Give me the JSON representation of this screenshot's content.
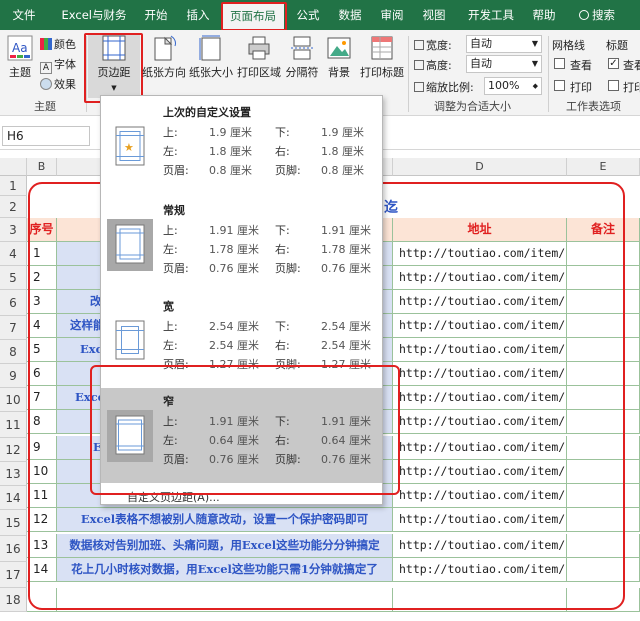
{
  "tabs": [
    "文件",
    "Excel与财务",
    "开始",
    "插入",
    "页面布局",
    "公式",
    "数据",
    "审阅",
    "视图",
    "开发工具",
    "帮助",
    "搜索"
  ],
  "active_tab_index": 4,
  "ribbon": {
    "theme_label": "主题",
    "theme_colors": "颜色",
    "theme_fonts": "字体",
    "theme_effects": "效果",
    "theme_group": "主题",
    "margins": "页边距",
    "orientation": "纸张方向",
    "size": "纸张大小",
    "print_area": "打印区域",
    "breaks": "分隔符",
    "background": "背景",
    "print_titles": "打印标题",
    "width_label": "宽度:",
    "width_value": "自动",
    "height_label": "高度:",
    "height_value": "自动",
    "scale_label": "缩放比例:",
    "scale_value": "100%",
    "fit_group": "调整为合适大小",
    "gridlines": "网格线",
    "headings": "标题",
    "view": "查看",
    "view2": "查看",
    "print": "打印",
    "print2": "打印",
    "sheet_options_group": "工作表选项"
  },
  "name_box": "H6",
  "columns": [
    "B",
    "D",
    "E"
  ],
  "rows": [
    "1",
    "2",
    "3",
    "4",
    "5",
    "6",
    "7",
    "8",
    "9",
    "10",
    "11",
    "12",
    "13",
    "14",
    "15",
    "16",
    "17",
    "18"
  ],
  "sheet": {
    "title_fragment": "迄",
    "h_seq": "序号",
    "h_addr": "地址",
    "h_note": "备注",
    "seq": [
      "1",
      "2",
      "3",
      "4",
      "5",
      "6",
      "7",
      "8",
      "9",
      "10",
      "11",
      "12",
      "13",
      "14"
    ],
    "url": "http://toutiao.com/item/",
    "frag_r6": "改",
    "frag_r7": "这样能",
    "frag_r8": "Exc",
    "frag_r10": "Excel",
    "frag_r12": "E",
    "row15": "Excel表格不想被别人随意改动，设置一个保护密码即可",
    "row16": "数据核对告别加班、头痛问题，用Excel这些功能分分钟搞定",
    "row17": "花上几小时核对数据，用Excel这些功能只需1分钟就搞定了"
  },
  "margins_menu": [
    {
      "name": "上次的自定义设置",
      "top": "1.9 厘米",
      "bottom": "1.9 厘米",
      "left": "1.8 厘米",
      "right": "1.8 厘米",
      "header": "0.8 厘米",
      "footer": "0.8 厘米"
    },
    {
      "name": "常规",
      "top": "1.91 厘米",
      "bottom": "1.91 厘米",
      "left": "1.78 厘米",
      "right": "1.78 厘米",
      "header": "0.76 厘米",
      "footer": "0.76 厘米"
    },
    {
      "name": "宽",
      "top": "2.54 厘米",
      "bottom": "2.54 厘米",
      "left": "2.54 厘米",
      "right": "2.54 厘米",
      "header": "1.27 厘米",
      "footer": "1.27 厘米"
    },
    {
      "name": "窄",
      "top": "1.91 厘米",
      "bottom": "1.91 厘米",
      "left": "0.64 厘米",
      "right": "0.64 厘米",
      "header": "0.76 厘米",
      "footer": "0.76 厘米"
    }
  ],
  "labels": {
    "top": "上:",
    "bottom": "下:",
    "left": "左:",
    "right": "右:",
    "header": "页眉:",
    "footer": "页脚:"
  },
  "custom_margins": "自定义页边距(A)...",
  "colors": {
    "excel_green": "#217346",
    "highlight_red": "#e02020",
    "cell_blue": "#d9e1f4",
    "text_blue": "#2e55c4"
  }
}
